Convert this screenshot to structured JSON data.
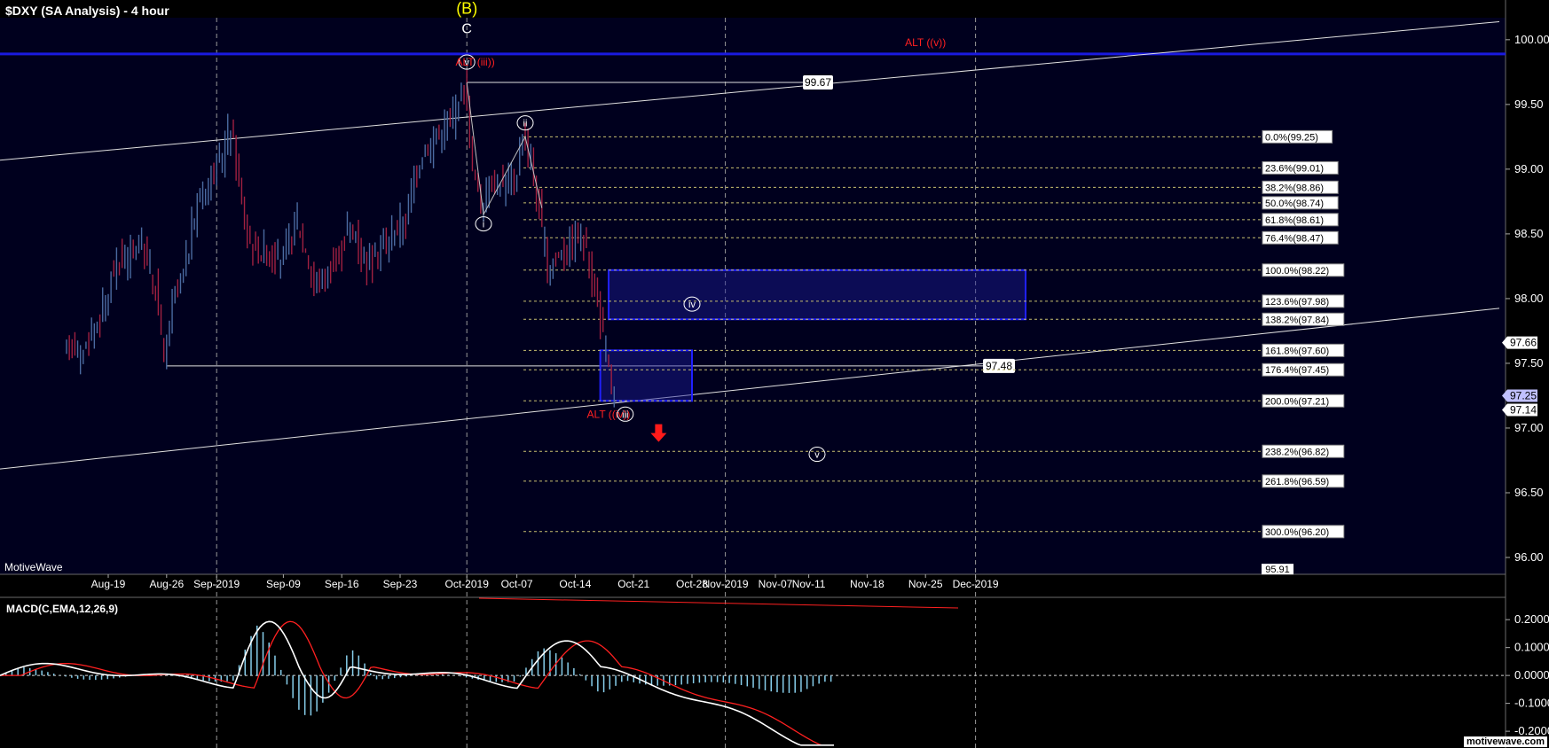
{
  "window": {
    "title": "$DXY (SA Analysis) - 4 hour",
    "watermark": "MotiveWave",
    "logo": "motivewave.com"
  },
  "colors": {
    "background": "#000000",
    "plot_bg": "#00001e",
    "up_bar": "#4a6aa0",
    "down_bar": "#a02040",
    "wave": "#ffffff",
    "alt": "#ff2020",
    "zone": "#1a1a9a",
    "fib": "#c8c070",
    "macd_hist": "#87ceeb",
    "macd_line": "#ffffff",
    "signal_line": "#ff2020"
  },
  "chart_data": [
    {
      "type": "candlestick",
      "title": "$DXY (SA Analysis) - 4 hour",
      "y_axis": {
        "ylim": [
          95.87,
          100.17
        ],
        "ticks": [
          "100.00",
          "99.50",
          "99.00",
          "98.50",
          "98.00",
          "97.50",
          "97.00",
          "96.50",
          "96.00"
        ]
      },
      "x_axis": {
        "labels": [
          "Aug-19",
          "Aug-26",
          "Sep-2019",
          "Sep-09",
          "Sep-16",
          "Sep-23",
          "Oct-2019",
          "Oct-07",
          "Oct-14",
          "Oct-21",
          "Oct-28",
          "Nov-2019",
          "Nov-07",
          "Nov-11",
          "Nov-18",
          "Nov-25",
          "Dec-2019"
        ],
        "grid_months": [
          "Sep-2019",
          "Oct-2019",
          "Nov-2019",
          "Dec-2019"
        ]
      },
      "price_series": [
        {
          "date": "Aug-14",
          "value": 97.55
        },
        {
          "date": "Aug-15",
          "value": 97.7
        },
        {
          "date": "Aug-16",
          "value": 97.55
        },
        {
          "date": "Aug-19",
          "value": 97.95
        },
        {
          "date": "Aug-20",
          "value": 98.25
        },
        {
          "date": "Aug-21",
          "value": 98.3
        },
        {
          "date": "Aug-22",
          "value": 98.35
        },
        {
          "date": "Aug-23",
          "value": 98.45
        },
        {
          "date": "Aug-24",
          "value": 98.3
        },
        {
          "date": "Aug-25",
          "value": 98.1
        },
        {
          "date": "Aug-26",
          "value": 97.5
        },
        {
          "date": "Aug-27",
          "value": 97.95
        },
        {
          "date": "Aug-28",
          "value": 98.1
        },
        {
          "date": "Aug-29",
          "value": 98.4
        },
        {
          "date": "Aug-30",
          "value": 98.75
        },
        {
          "date": "Sep-02",
          "value": 99.1
        },
        {
          "date": "Sep-03",
          "value": 99.35
        },
        {
          "date": "Sep-04",
          "value": 98.9
        },
        {
          "date": "Sep-05",
          "value": 98.5
        },
        {
          "date": "Sep-06",
          "value": 98.4
        },
        {
          "date": "Sep-09",
          "value": 98.3
        },
        {
          "date": "Sep-10",
          "value": 98.4
        },
        {
          "date": "Sep-11",
          "value": 98.6
        },
        {
          "date": "Sep-12",
          "value": 98.4
        },
        {
          "date": "Sep-13",
          "value": 98.1
        },
        {
          "date": "Sep-16",
          "value": 98.3
        },
        {
          "date": "Sep-17",
          "value": 98.55
        },
        {
          "date": "Sep-18",
          "value": 98.5
        },
        {
          "date": "Sep-19",
          "value": 98.3
        },
        {
          "date": "Sep-20",
          "value": 98.3
        },
        {
          "date": "Sep-23",
          "value": 98.55
        },
        {
          "date": "Sep-24",
          "value": 98.6
        },
        {
          "date": "Sep-25",
          "value": 98.9
        },
        {
          "date": "Sep-26",
          "value": 99.15
        },
        {
          "date": "Sep-27",
          "value": 99.2
        },
        {
          "date": "Sep-30",
          "value": 99.45
        },
        {
          "date": "Oct-01",
          "value": 99.67
        },
        {
          "date": "Oct-02",
          "value": 99.05
        },
        {
          "date": "Oct-03",
          "value": 98.7
        },
        {
          "date": "Oct-04",
          "value": 98.9
        },
        {
          "date": "Oct-07",
          "value": 98.9
        },
        {
          "date": "Oct-08",
          "value": 99.25
        },
        {
          "date": "Oct-09",
          "value": 99.05
        },
        {
          "date": "Oct-10",
          "value": 98.65
        },
        {
          "date": "Oct-11",
          "value": 98.25
        },
        {
          "date": "Oct-14",
          "value": 98.45
        },
        {
          "date": "Oct-15",
          "value": 98.5
        },
        {
          "date": "Oct-16",
          "value": 98.3
        },
        {
          "date": "Oct-17",
          "value": 97.95
        },
        {
          "date": "Oct-18",
          "value": 97.55
        },
        {
          "date": "Oct-19",
          "value": 97.25
        }
      ],
      "horizontal_levels": [
        {
          "label": "99.67",
          "value": 99.67
        },
        {
          "label": "97.48",
          "value": 97.48
        }
      ],
      "fib_levels": [
        {
          "label": "0.0%(99.25)",
          "value": 99.25
        },
        {
          "label": "23.6%(99.01)",
          "value": 99.01
        },
        {
          "label": "38.2%(98.86)",
          "value": 98.86
        },
        {
          "label": "50.0%(98.74)",
          "value": 98.74
        },
        {
          "label": "61.8%(98.61)",
          "value": 98.61
        },
        {
          "label": "76.4%(98.47)",
          "value": 98.47
        },
        {
          "label": "100.0%(98.22)",
          "value": 98.22
        },
        {
          "label": "123.6%(97.98)",
          "value": 97.98
        },
        {
          "label": "138.2%(97.84)",
          "value": 97.84
        },
        {
          "label": "161.8%(97.60)",
          "value": 97.6
        },
        {
          "label": "176.4%(97.45)",
          "value": 97.45
        },
        {
          "label": "200.0%(97.21)",
          "value": 97.21
        },
        {
          "label": "238.2%(96.82)",
          "value": 96.82
        },
        {
          "label": "261.8%(96.59)",
          "value": 96.59
        },
        {
          "label": "300.0%(96.20)",
          "value": 96.2
        },
        {
          "label": "95.91",
          "value": 95.91
        }
      ],
      "price_tags": [
        {
          "label": "97.66",
          "value": 97.66
        },
        {
          "label": "97.25",
          "value": 97.25
        },
        {
          "label": "97.14",
          "value": 97.14
        }
      ],
      "wave_labels": [
        {
          "text": "(B)",
          "date": "Oct-01",
          "value": 100.2,
          "color": "#ffff00"
        },
        {
          "text": "C",
          "date": "Oct-01",
          "value": 100.05,
          "color": "#ffffff"
        },
        {
          "text": "(v)",
          "date": "Oct-01",
          "value": 99.8,
          "color": "#ffffff"
        },
        {
          "text": "ALT (iii))",
          "date": "Oct-02",
          "value": 99.8,
          "color": "#ff2020"
        },
        {
          "text": "(ii)",
          "date": "Oct-08",
          "value": 99.33,
          "color": "#ffffff"
        },
        {
          "text": "(i)",
          "date": "Oct-03",
          "value": 98.55,
          "color": "#ffffff"
        },
        {
          "text": "(iv)",
          "date": "Oct-28",
          "value": 97.93,
          "color": "#ffffff"
        },
        {
          "text": "ALT ((iv))",
          "date": "Oct-18",
          "value": 97.08,
          "color": "#ff2020"
        },
        {
          "text": "(iii)",
          "date": "Oct-20",
          "value": 97.08,
          "color": "#ffffff"
        },
        {
          "text": "(v)",
          "date": "Nov-12",
          "value": 96.77,
          "color": "#ffffff"
        },
        {
          "text": "ALT ((v))",
          "date": "Nov-25",
          "value": 99.95,
          "color": "#ff2020"
        }
      ],
      "zones": [
        {
          "name": "target-zone-iv",
          "from_date": "Oct-18",
          "to_date": "Dec-07",
          "low": 97.84,
          "high": 98.22
        },
        {
          "name": "target-zone-iii",
          "from_date": "Oct-17",
          "to_date": "Oct-28",
          "low": 97.21,
          "high": 97.6
        }
      ],
      "blue_line_value": 99.89
    },
    {
      "type": "line",
      "title": "MACD(C,EMA,12,26,9)",
      "y_axis": {
        "ylim": [
          -0.26,
          0.28
        ],
        "ticks": [
          "0.2000",
          "0.1000",
          "0.0000",
          "-0.1000",
          "-0.2000"
        ]
      },
      "series": [
        {
          "name": "MACD"
        },
        {
          "name": "Signal"
        },
        {
          "name": "Histogram"
        }
      ]
    }
  ]
}
